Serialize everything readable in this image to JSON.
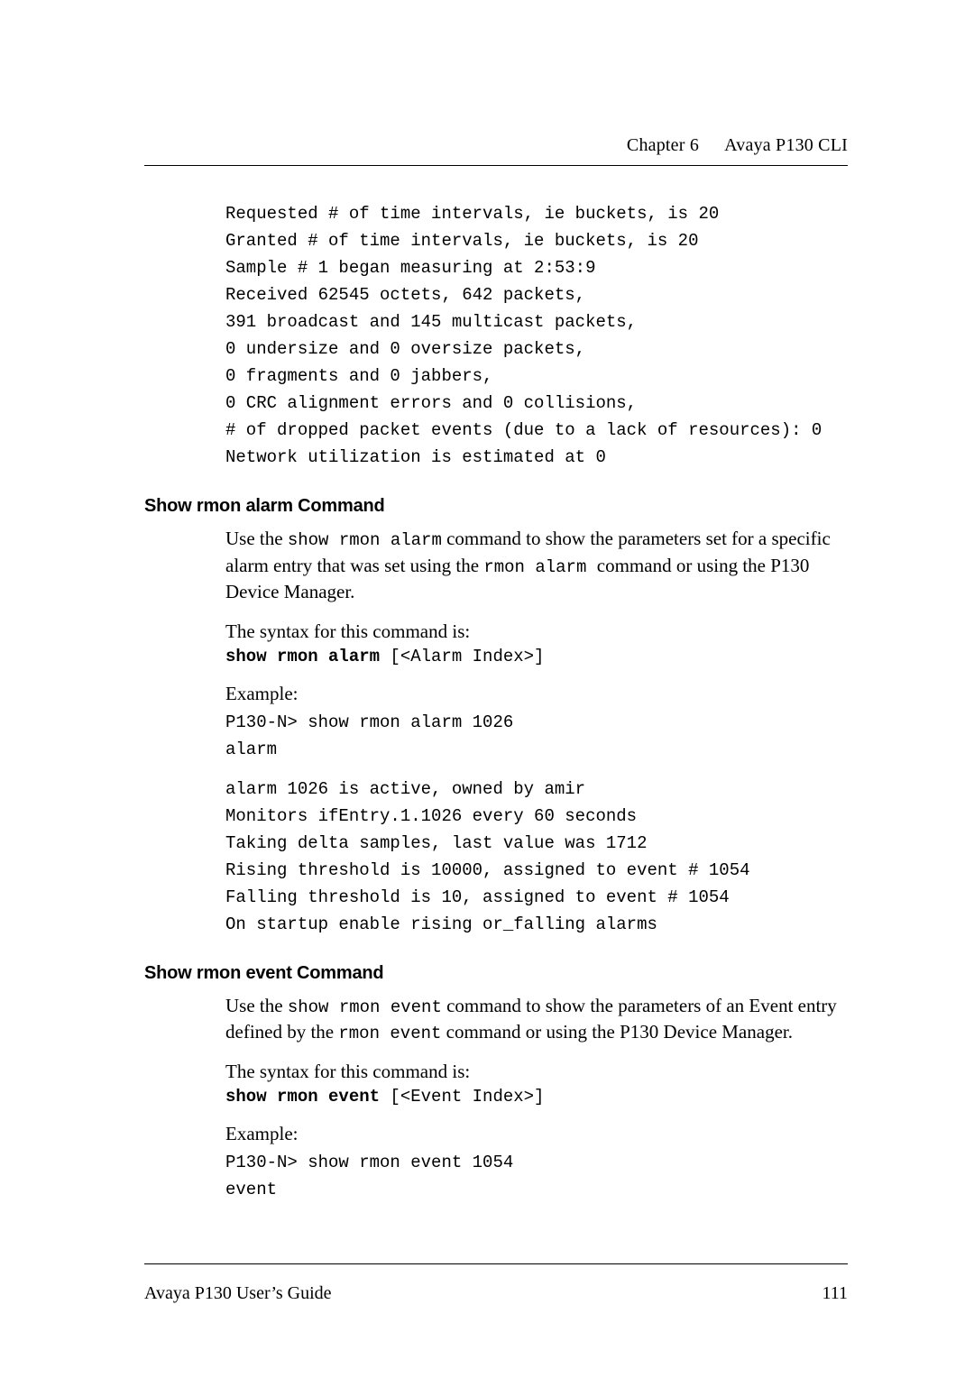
{
  "header": {
    "chapter_label": "Chapter 6",
    "chapter_title": "Avaya P130 CLI"
  },
  "code_block_1": "Requested # of time intervals, ie buckets, is 20\nGranted # of time intervals, ie buckets, is 20\nSample # 1 began measuring at 2:53:9\nReceived 62545 octets, 642 packets,\n391 broadcast and 145 multicast packets,\n0 undersize and 0 oversize packets,\n0 fragments and 0 jabbers,\n0 CRC alignment errors and 0 collisions,\n# of dropped packet events (due to a lack of resources): 0\nNetwork utilization is estimated at 0",
  "section1": {
    "heading": "Show rmon alarm Command",
    "para_parts": {
      "p1": "Use the ",
      "m1": "show rmon alarm",
      "p2": " command to show the parameters set for a specific alarm entry that was set using the ",
      "m2": "rmon alarm ",
      "p3": " command or using the P130 Device Manager."
    },
    "syntax_label": "The syntax for this command is:",
    "syntax_bold": "show rmon alarm",
    "syntax_rest": " [<Alarm Index>]",
    "example_label": "Example:",
    "example_code": "P130-N> show rmon alarm 1026\nalarm",
    "output_code": "alarm 1026 is active, owned by amir\nMonitors ifEntry.1.1026 every 60 seconds\nTaking delta samples, last value was 1712\nRising threshold is 10000, assigned to event # 1054\nFalling threshold is 10, assigned to event # 1054\nOn startup enable rising or_falling alarms"
  },
  "section2": {
    "heading": "Show rmon event Command",
    "para_parts": {
      "p1": "Use the ",
      "m1": "show rmon event",
      "p2": " command to show the parameters of an Event entry defined by the ",
      "m2": "rmon event",
      "p3": " command or using the P130 Device Manager."
    },
    "syntax_label": "The syntax for this command is:",
    "syntax_bold": "show rmon event",
    "syntax_rest": " [<Event Index>]",
    "example_label": "Example:",
    "example_code": "P130-N> show rmon event 1054\nevent"
  },
  "footer": {
    "left": "Avaya P130 User’s Guide",
    "right": "111"
  }
}
